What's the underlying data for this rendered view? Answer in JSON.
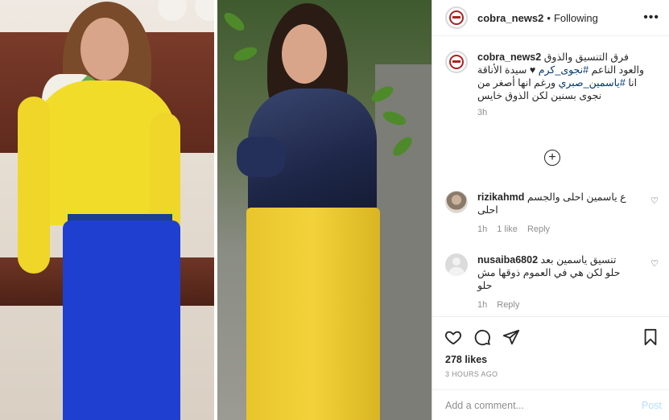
{
  "post": {
    "author": "cobra_news2",
    "separator": "•",
    "follow_status": "Following",
    "caption_line1": "فرق التنسيق والذوق",
    "caption_line2_pre": "والعود الناعم",
    "caption_hashtag1": "#نجوى_كرم",
    "caption_line2_post": "♥ سيدة الأناقة",
    "caption_line3_pre": "انا",
    "caption_hashtag2": "#ياسمين_صبري",
    "caption_line3_post": "ورغم انها أصغر من",
    "caption_line4": "نجوى بسنين لكن الذوق خايس",
    "time": "3h",
    "likes": "278 likes",
    "posted": "3 HOURS AGO"
  },
  "comments": [
    {
      "user": "rizikahmd",
      "text_line1": "ع ياسمين احلى والجسم",
      "text_line2": "احلى",
      "time": "1h",
      "likes": "1 like",
      "reply": "Reply"
    },
    {
      "user": "nusaiba6802",
      "text_line1": "تنسيق ياسمين بعد",
      "text_line2": "حلو لكن هي في العموم ذوقها مش",
      "text_line3": "حلو",
      "time": "1h",
      "reply": "Reply"
    }
  ],
  "add_comment": {
    "placeholder": "Add a comment...",
    "post_label": "Post"
  },
  "icons": {
    "more": "more-icon",
    "load_more": "plus-circle-icon",
    "like": "heart-icon",
    "comment": "comment-icon",
    "share": "share-icon",
    "save": "bookmark-icon"
  },
  "colors": {
    "link": "#00376b",
    "muted": "#8e8e8e",
    "post_button": "#b2dffc"
  }
}
